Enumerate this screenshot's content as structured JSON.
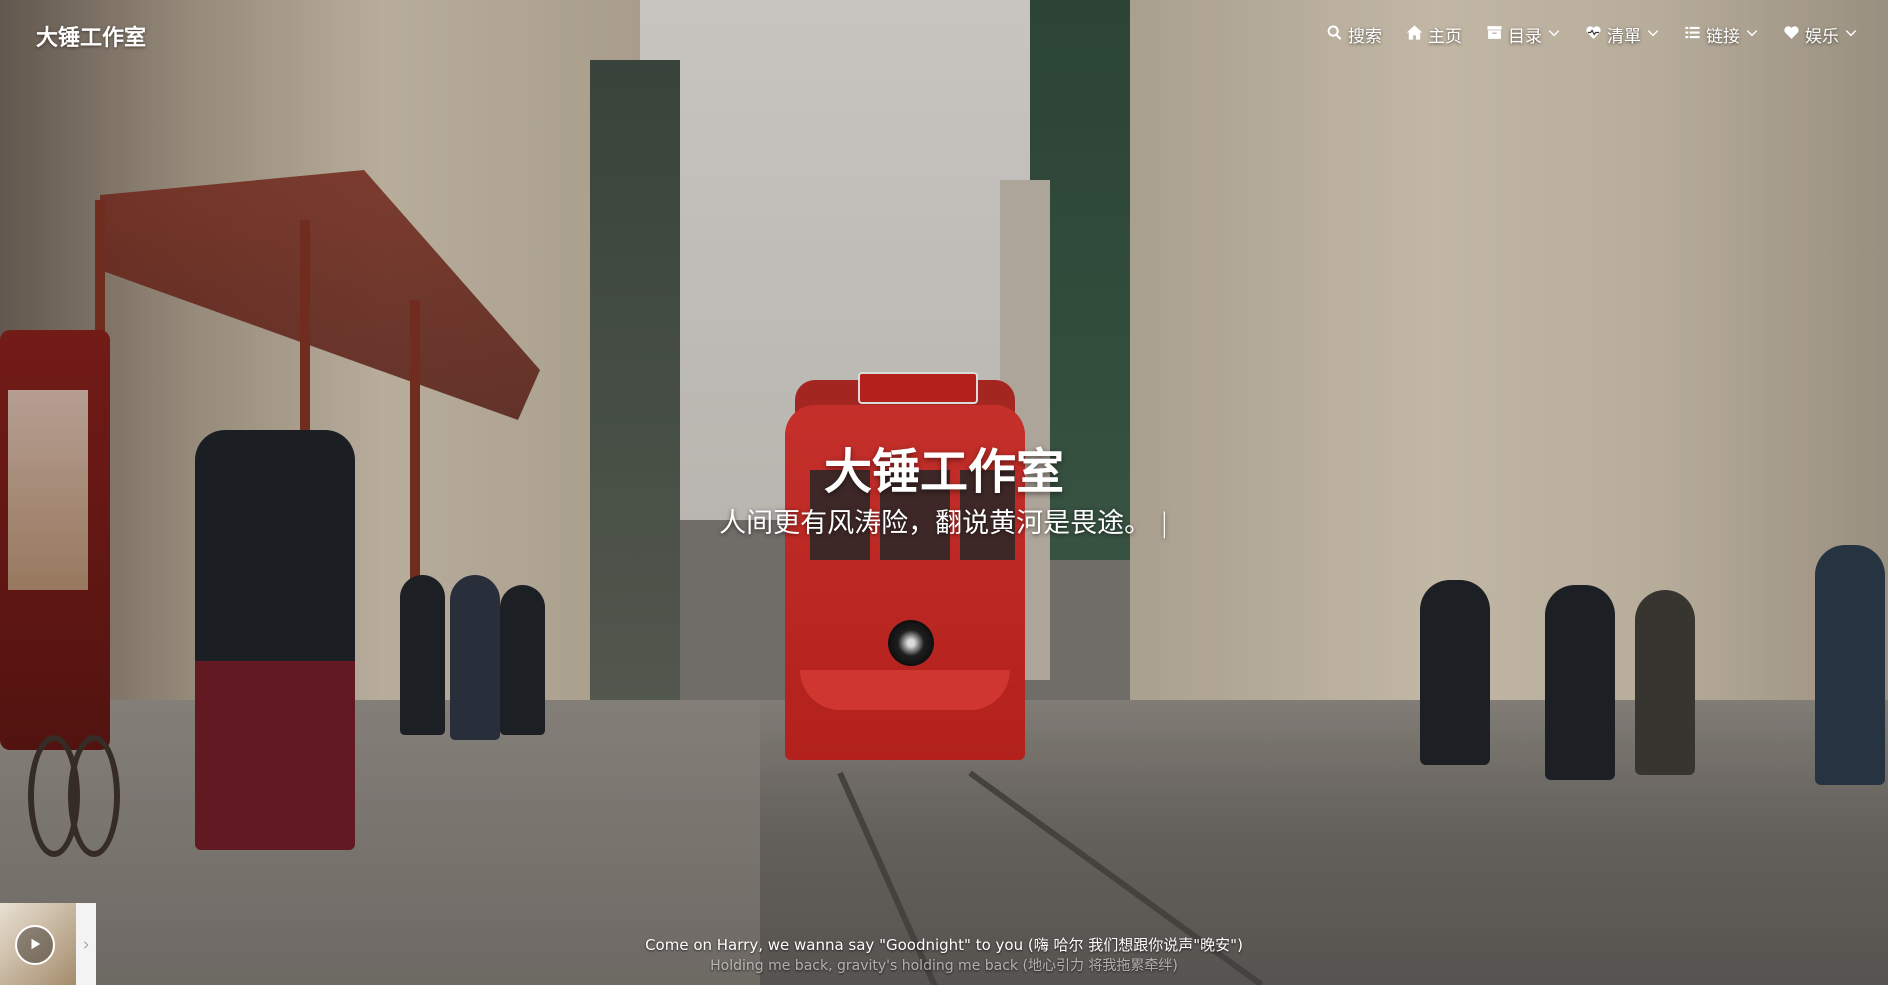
{
  "site": {
    "brand": "大锤工作室"
  },
  "nav": {
    "items": [
      {
        "label": "搜索",
        "icon": "search-icon",
        "has_dropdown": false
      },
      {
        "label": "主页",
        "icon": "home-icon",
        "has_dropdown": false
      },
      {
        "label": "目录",
        "icon": "archive-icon",
        "has_dropdown": true
      },
      {
        "label": "清單",
        "icon": "heartbeat-icon",
        "has_dropdown": true
      },
      {
        "label": "链接",
        "icon": "list-icon",
        "has_dropdown": true
      },
      {
        "label": "娱乐",
        "icon": "heart-icon",
        "has_dropdown": true
      }
    ]
  },
  "hero": {
    "title": "大锤工作室",
    "subtitle": "人间更有风涛险，翻说黄河是畏途。",
    "cursor": "|"
  },
  "player": {
    "state": "paused"
  },
  "lyrics": {
    "line1": "Come on Harry, we wanna say \"Goodnight\" to you (嗨 哈尔 我们想跟你说声\"晚安\")",
    "line2": "Holding me back, gravity's holding me back (地心引力 将我拖累牵绊)"
  }
}
